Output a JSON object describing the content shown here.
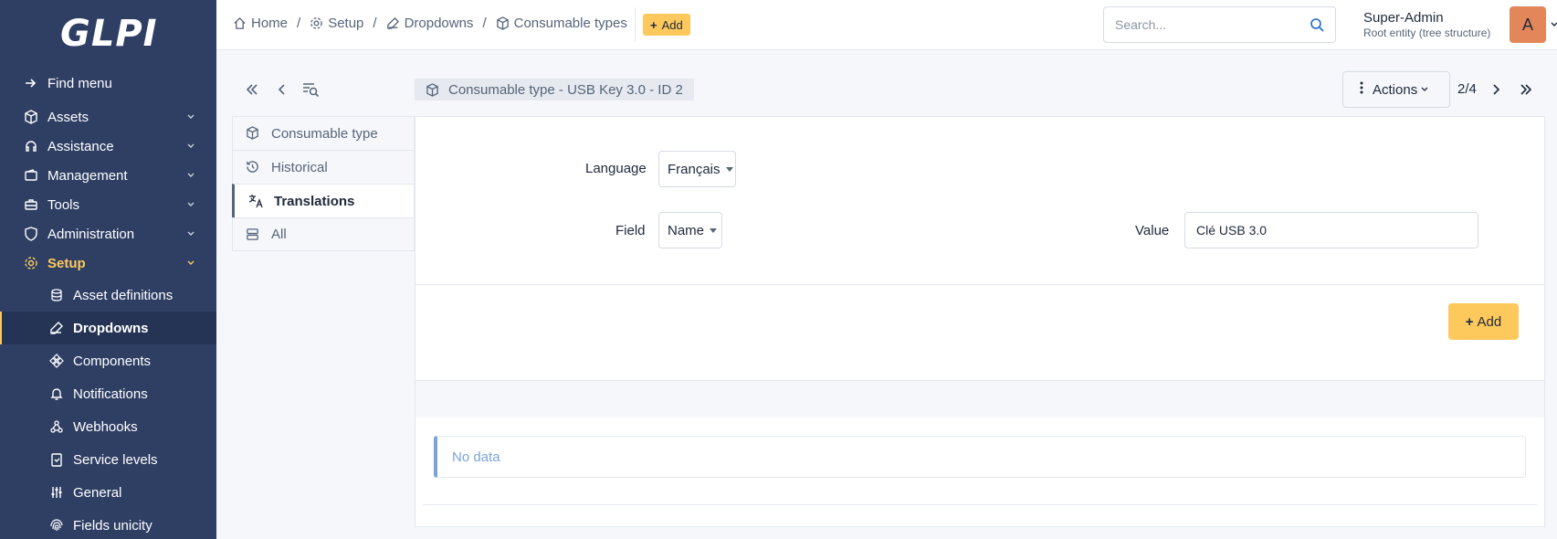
{
  "app": {
    "logo": "GLPI"
  },
  "sidebar": {
    "items": [
      {
        "label": "Find menu"
      },
      {
        "label": "Assets"
      },
      {
        "label": "Assistance"
      },
      {
        "label": "Management"
      },
      {
        "label": "Tools"
      },
      {
        "label": "Administration"
      },
      {
        "label": "Setup"
      }
    ],
    "subitems": [
      {
        "label": "Asset definitions"
      },
      {
        "label": "Dropdowns"
      },
      {
        "label": "Components"
      },
      {
        "label": "Notifications"
      },
      {
        "label": "Webhooks"
      },
      {
        "label": "Service levels"
      },
      {
        "label": "General"
      },
      {
        "label": "Fields unicity"
      }
    ]
  },
  "header": {
    "breadcrumb": [
      "Home",
      "Setup",
      "Dropdowns",
      "Consumable types"
    ],
    "separator": "/",
    "add_label": "Add",
    "search_placeholder": "Search...",
    "user_name": "Super-Admin",
    "user_entity": "Root entity (tree structure)",
    "avatar_initial": "A"
  },
  "navbar": {
    "item_title": "Consumable type -  USB Key 3.0 - ID 2",
    "actions_label": "Actions",
    "counter": "2/4"
  },
  "tabs": [
    {
      "label": "Consumable type"
    },
    {
      "label": "Historical"
    },
    {
      "label": "Translations"
    },
    {
      "label": "All"
    }
  ],
  "form": {
    "language_label": "Language",
    "language_value": "Français",
    "field_label": "Field",
    "field_value": "Name",
    "value_label": "Value",
    "value_value": "Clé USB 3.0",
    "add_label": "Add"
  },
  "list": {
    "empty_text": "No data"
  },
  "colors": {
    "sidebar_bg": "#2f3f64",
    "accent": "#fec95c",
    "info": "#7aa3d8",
    "avatar": "#e3875a"
  }
}
